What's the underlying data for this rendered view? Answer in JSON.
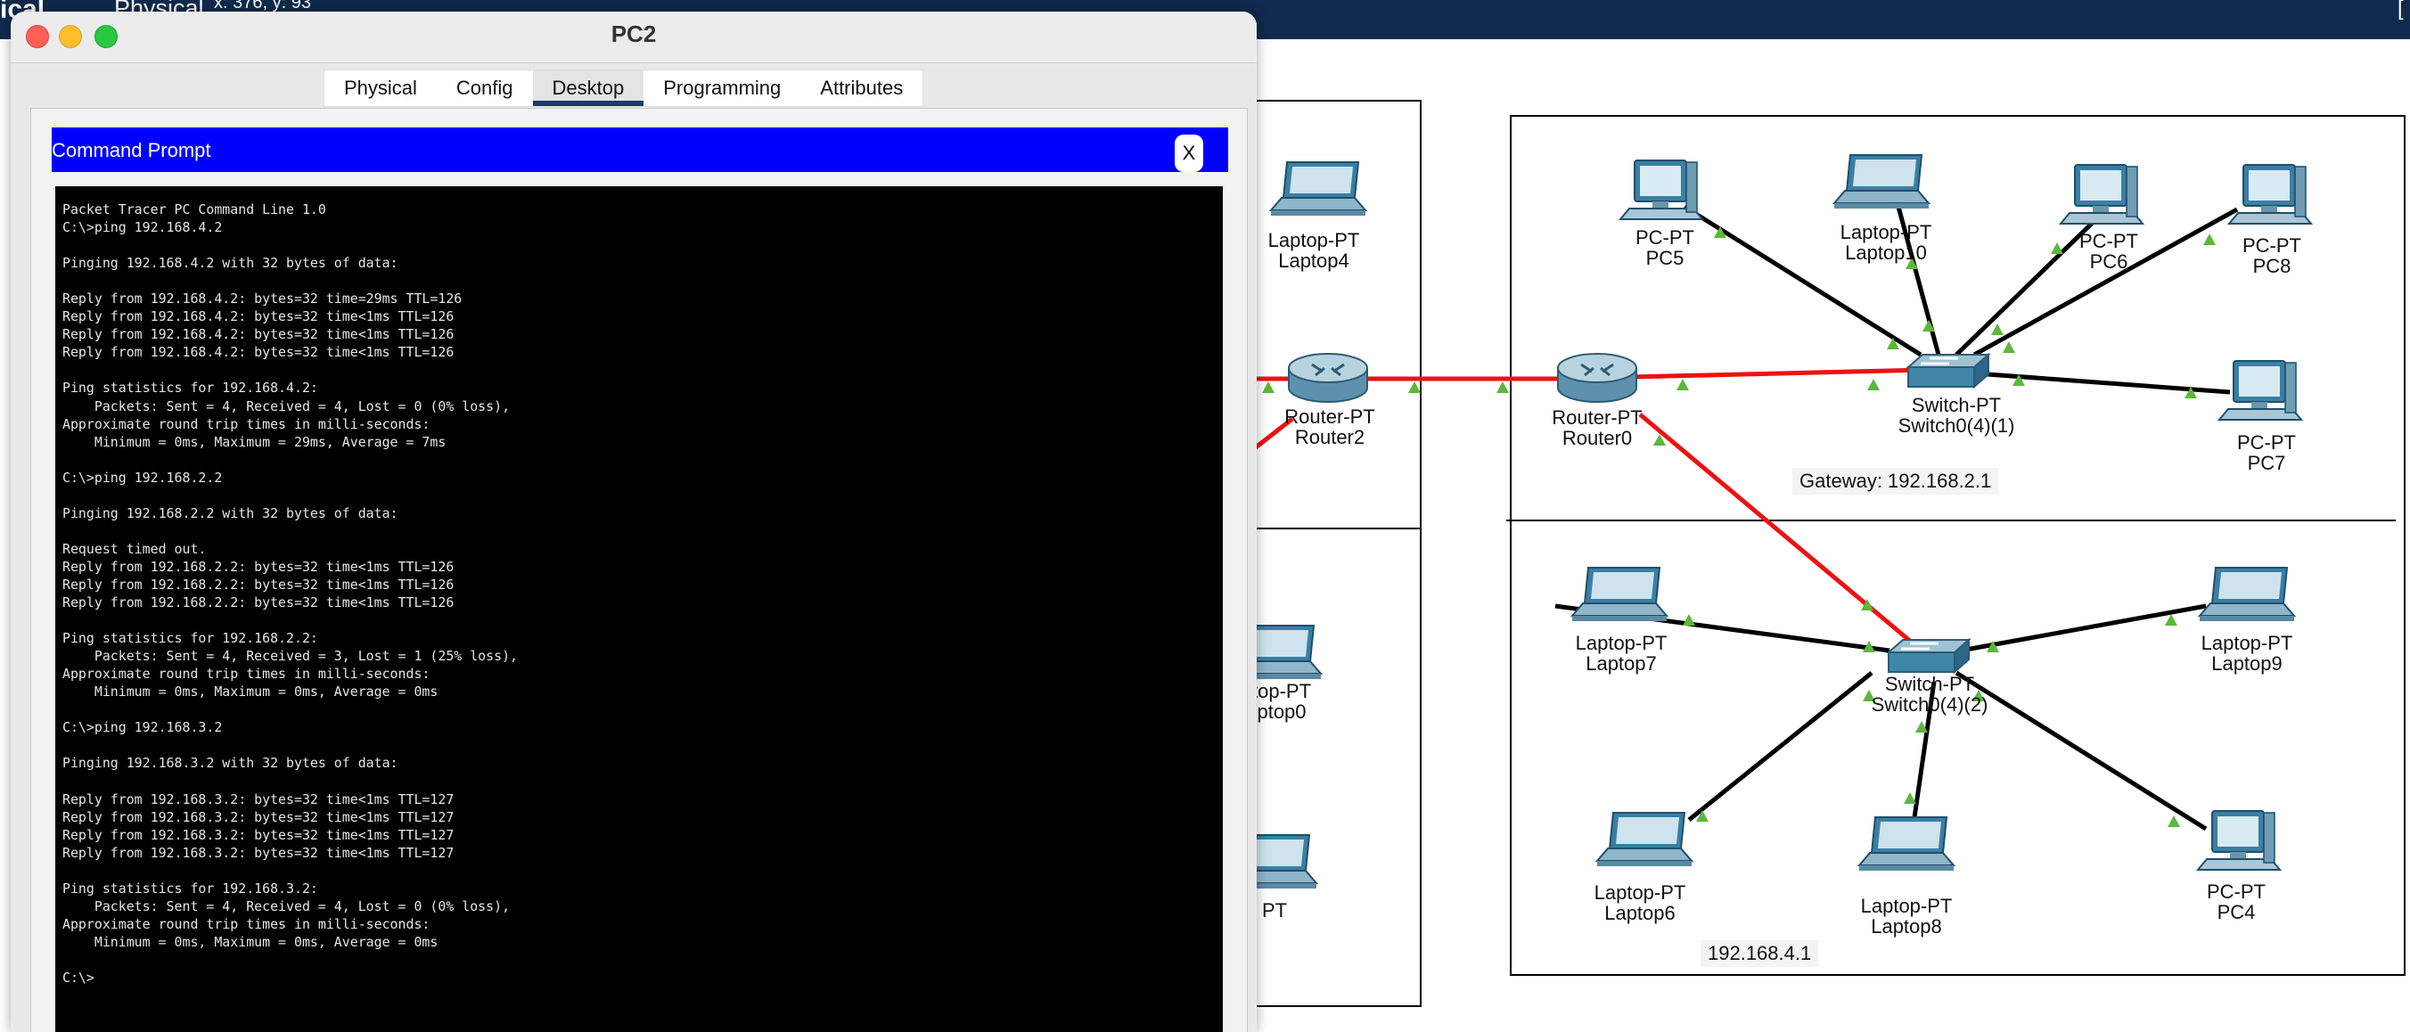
{
  "app": {
    "mode_label": "ical",
    "view_label": "Physical",
    "coords": "x: 376, y: 93",
    "right_bracket": "["
  },
  "window": {
    "title": "PC2",
    "tabs": [
      {
        "label": "Physical",
        "active": false
      },
      {
        "label": "Config",
        "active": false
      },
      {
        "label": "Desktop",
        "active": true
      },
      {
        "label": "Programming",
        "active": false
      },
      {
        "label": "Attributes",
        "active": false
      }
    ],
    "command_prompt": {
      "title": "Command Prompt",
      "close_label": "X",
      "lines": [
        "Packet Tracer PC Command Line 1.0",
        "C:\\>ping 192.168.4.2",
        "",
        "Pinging 192.168.4.2 with 32 bytes of data:",
        "",
        "Reply from 192.168.4.2: bytes=32 time=29ms TTL=126",
        "Reply from 192.168.4.2: bytes=32 time<1ms TTL=126",
        "Reply from 192.168.4.2: bytes=32 time<1ms TTL=126",
        "Reply from 192.168.4.2: bytes=32 time<1ms TTL=126",
        "",
        "Ping statistics for 192.168.4.2:",
        "    Packets: Sent = 4, Received = 4, Lost = 0 (0% loss),",
        "Approximate round trip times in milli-seconds:",
        "    Minimum = 0ms, Maximum = 29ms, Average = 7ms",
        "",
        "C:\\>ping 192.168.2.2",
        "",
        "Pinging 192.168.2.2 with 32 bytes of data:",
        "",
        "Request timed out.",
        "Reply from 192.168.2.2: bytes=32 time<1ms TTL=126",
        "Reply from 192.168.2.2: bytes=32 time<1ms TTL=126",
        "Reply from 192.168.2.2: bytes=32 time<1ms TTL=126",
        "",
        "Ping statistics for 192.168.2.2:",
        "    Packets: Sent = 4, Received = 3, Lost = 1 (25% loss),",
        "Approximate round trip times in milli-seconds:",
        "    Minimum = 0ms, Maximum = 0ms, Average = 0ms",
        "",
        "C:\\>ping 192.168.3.2",
        "",
        "Pinging 192.168.3.2 with 32 bytes of data:",
        "",
        "Reply from 192.168.3.2: bytes=32 time<1ms TTL=127",
        "Reply from 192.168.3.2: bytes=32 time<1ms TTL=127",
        "Reply from 192.168.3.2: bytes=32 time<1ms TTL=127",
        "Reply from 192.168.3.2: bytes=32 time<1ms TTL=127",
        "",
        "Ping statistics for 192.168.3.2:",
        "    Packets: Sent = 4, Received = 4, Lost = 0 (0% loss),",
        "Approximate round trip times in milli-seconds:",
        "    Minimum = 0ms, Maximum = 0ms, Average = 0ms",
        "",
        "C:\\>"
      ]
    }
  },
  "topology": {
    "devices": [
      {
        "id": "laptop4",
        "model": "Laptop-PT",
        "name": "Laptop4",
        "icon": "laptop-icon"
      },
      {
        "id": "router2",
        "model": "Router-PT",
        "name": "Router2",
        "icon": "router-icon"
      },
      {
        "id": "laptop0",
        "model": "top-PT",
        "name": "ptop0",
        "icon": "laptop-icon"
      },
      {
        "id": "partial",
        "model": "PT",
        "name": "",
        "icon": "laptop-icon"
      },
      {
        "id": "router0",
        "model": "Router-PT",
        "name": "Router0",
        "icon": "router-icon"
      },
      {
        "id": "switch1",
        "model": "Switch-PT",
        "name": "Switch0(4)(1)",
        "icon": "switch-icon"
      },
      {
        "id": "pc5",
        "model": "PC-PT",
        "name": "PC5",
        "icon": "pc-icon"
      },
      {
        "id": "laptop10",
        "model": "Laptop-PT",
        "name": "Laptop10",
        "icon": "laptop-icon"
      },
      {
        "id": "pc6",
        "model": "PC-PT",
        "name": "PC6",
        "icon": "pc-icon"
      },
      {
        "id": "pc8",
        "model": "PC-PT",
        "name": "PC8",
        "icon": "pc-icon"
      },
      {
        "id": "pc7",
        "model": "PC-PT",
        "name": "PC7",
        "icon": "pc-icon"
      },
      {
        "id": "switch2",
        "model": "Switch-PT",
        "name": "Switch0(4)(2)",
        "icon": "switch-icon"
      },
      {
        "id": "laptop7",
        "model": "Laptop-PT",
        "name": "Laptop7",
        "icon": "laptop-icon"
      },
      {
        "id": "laptop9",
        "model": "Laptop-PT",
        "name": "Laptop9",
        "icon": "laptop-icon"
      },
      {
        "id": "laptop6",
        "model": "Laptop-PT",
        "name": "Laptop6",
        "icon": "laptop-icon"
      },
      {
        "id": "laptop8",
        "model": "Laptop-PT",
        "name": "Laptop8",
        "icon": "laptop-icon"
      },
      {
        "id": "pc4",
        "model": "PC-PT",
        "name": "PC4",
        "icon": "pc-icon"
      }
    ],
    "notes": {
      "gateway": "Gateway: 192.168.2.1",
      "subnet": "192.168.4.1"
    },
    "colors": {
      "router_link": "#ee1111",
      "device_link": "#000000",
      "link_up": "#5cb83a"
    }
  }
}
